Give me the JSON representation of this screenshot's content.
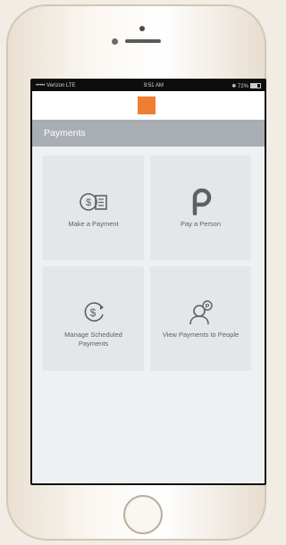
{
  "statusbar": {
    "carrier": "••••• Verizon LTE",
    "time": "9:51 AM",
    "battery": "✱ 72%"
  },
  "header": {
    "title": "Payments"
  },
  "tiles": [
    {
      "label": "Make a Payment",
      "icon": "money-payment-icon"
    },
    {
      "label": "Pay a Person",
      "icon": "p-person-icon"
    },
    {
      "label": "Manage Scheduled Payments",
      "icon": "scheduled-dollar-icon"
    },
    {
      "label": "View Payments to People",
      "icon": "person-payment-icon"
    }
  ],
  "colors": {
    "brand": "#ef7e33",
    "titlebar": "#a8aeb4",
    "tile": "#e4e6e8",
    "icon": "#5d6166"
  }
}
